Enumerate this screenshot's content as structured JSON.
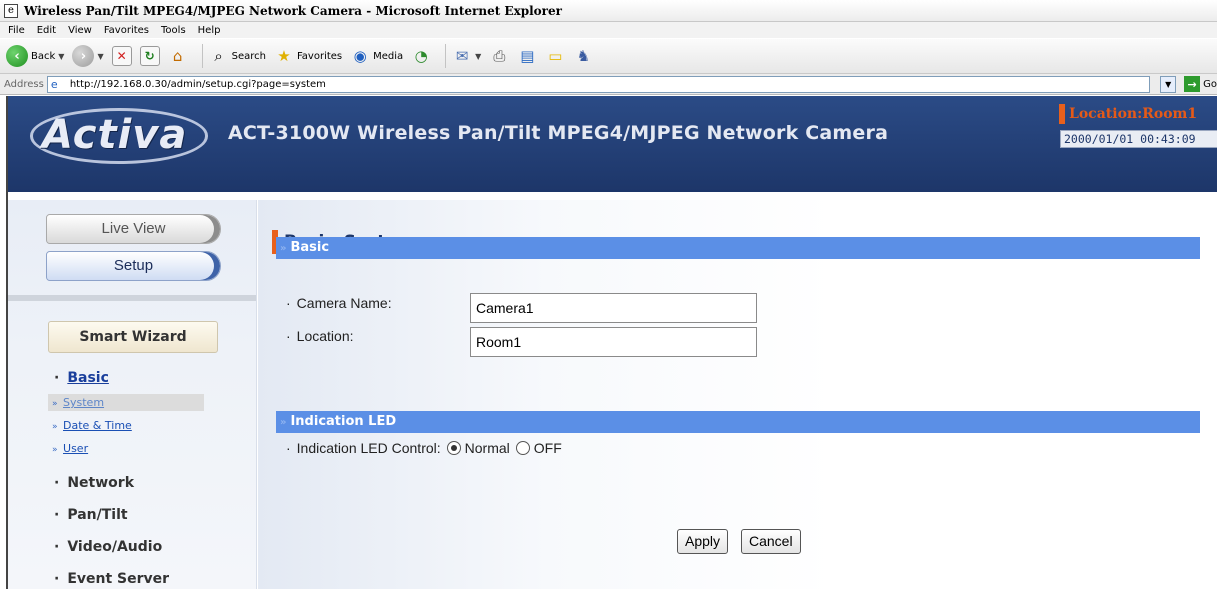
{
  "window": {
    "title": "Wireless Pan/Tilt MPEG4/MJPEG Network Camera - Microsoft Internet Explorer"
  },
  "menubar": [
    "File",
    "Edit",
    "View",
    "Favorites",
    "Tools",
    "Help"
  ],
  "toolbar": {
    "back_label": "Back",
    "search_label": "Search",
    "favorites_label": "Favorites",
    "media_label": "Media"
  },
  "address": {
    "label": "Address",
    "url": "http://192.168.0.30/admin/setup.cgi?page=system",
    "go_label": "Go"
  },
  "header": {
    "logo": "Activa",
    "product_title": "ACT-3100W Wireless Pan/Tilt MPEG4/MJPEG Network Camera",
    "location": "Location:Room1",
    "datetime": "2000/01/01 00:43:09"
  },
  "sidebar": {
    "live_view": "Live View",
    "setup": "Setup",
    "smart_wizard": "Smart Wizard",
    "bullet": "·",
    "sub_arrow": "»",
    "basic": "Basic",
    "basic_items": [
      "System",
      "Date & Time",
      "User"
    ],
    "network": "Network",
    "pan_tilt": "Pan/Tilt",
    "video_audio": "Video/Audio",
    "event_server": "Event Server"
  },
  "main": {
    "title_part1": "Basic",
    "title_sep": "»",
    "title_part2": "System",
    "section_chevron": "»",
    "section_basic": "Basic",
    "camera_name_label": "Camera Name:",
    "camera_name_value": "Camera1",
    "location_label": "Location:",
    "location_value": "Room1",
    "section_led": "Indication LED",
    "led_label": "Indication LED Control:",
    "led_normal": "Normal",
    "led_off": "OFF",
    "led_selected": "Normal",
    "apply": "Apply",
    "cancel": "Cancel"
  },
  "colors": {
    "header_bg": "#1d3669",
    "accent_orange": "#e8601c",
    "section_blue": "#5b8fe6"
  }
}
